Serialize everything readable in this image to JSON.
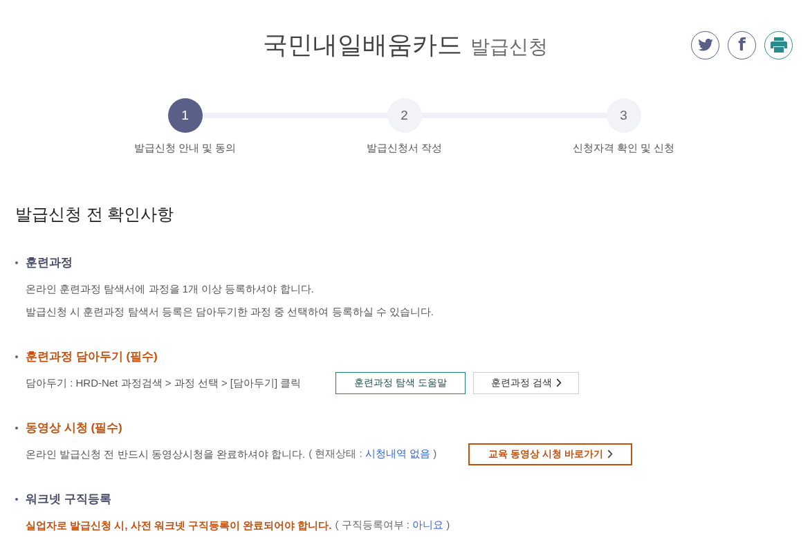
{
  "header": {
    "title": "국민내일배움카드",
    "subtitle": "발급신청"
  },
  "share_buttons": [
    {
      "kind": "bird"
    },
    {
      "kind": "letter",
      "text": "f"
    },
    {
      "kind": "printer"
    }
  ],
  "steps": [
    {
      "number": "1",
      "label": "발급신청 안내 및 동의",
      "selected": true
    },
    {
      "number": "2",
      "label": "발급신청서 작성",
      "selected": false
    },
    {
      "number": "3",
      "label": "신청자격 확인 및 신청",
      "selected": false
    }
  ],
  "heading": "발급신청 전 확인사항",
  "sections": [
    {
      "title": "훈련과정",
      "required": false,
      "lines": [
        {
          "kind": "plain",
          "text": "온라인 훈련과정 탐색서에 과정을 1개 이상 등록하셔야 합니다."
        },
        {
          "kind": "plain",
          "text": "발급신청 시 훈련과정 탐색서 등록은 담아두기한 과정 중 선택하여 등록하실 수 있습니다."
        }
      ]
    },
    {
      "title": "훈련과정 담아두기 (필수)",
      "required": true,
      "lines": [
        {
          "kind": "plain",
          "text": "담아두기 : HRD-Net 과정검색 > 과정 선택 > [담아두기] 클릭",
          "buttons": [
            {
              "label": "훈련과정 탐색 도움말",
              "kind": "guide"
            },
            {
              "label": "훈련과정 검색",
              "kind": "search"
            }
          ]
        }
      ]
    },
    {
      "title": "동영상 시청 (필수)",
      "required": true,
      "lines": [
        {
          "kind": "plain",
          "text": "온라인 발급신청 전 반드시 동영상시청을 완료하셔야 합니다.",
          "status": {
            "open": "( 현재상태 :",
            "value": "시청내역 없음",
            "close": ")"
          },
          "buttons": [
            {
              "label": "교육 동영상 시청 바로가기",
              "kind": "shortcut"
            }
          ]
        }
      ]
    },
    {
      "title": "워크넷 구직등록",
      "required": false,
      "lines": [
        {
          "kind": "notice",
          "text": "실업자로 발급신청 시, 사전 워크넷 구직등록이 완료되어야 합니다.",
          "status": {
            "open": "( 구직등록여부 :",
            "value": "아니요",
            "close": ")"
          }
        }
      ]
    }
  ]
}
